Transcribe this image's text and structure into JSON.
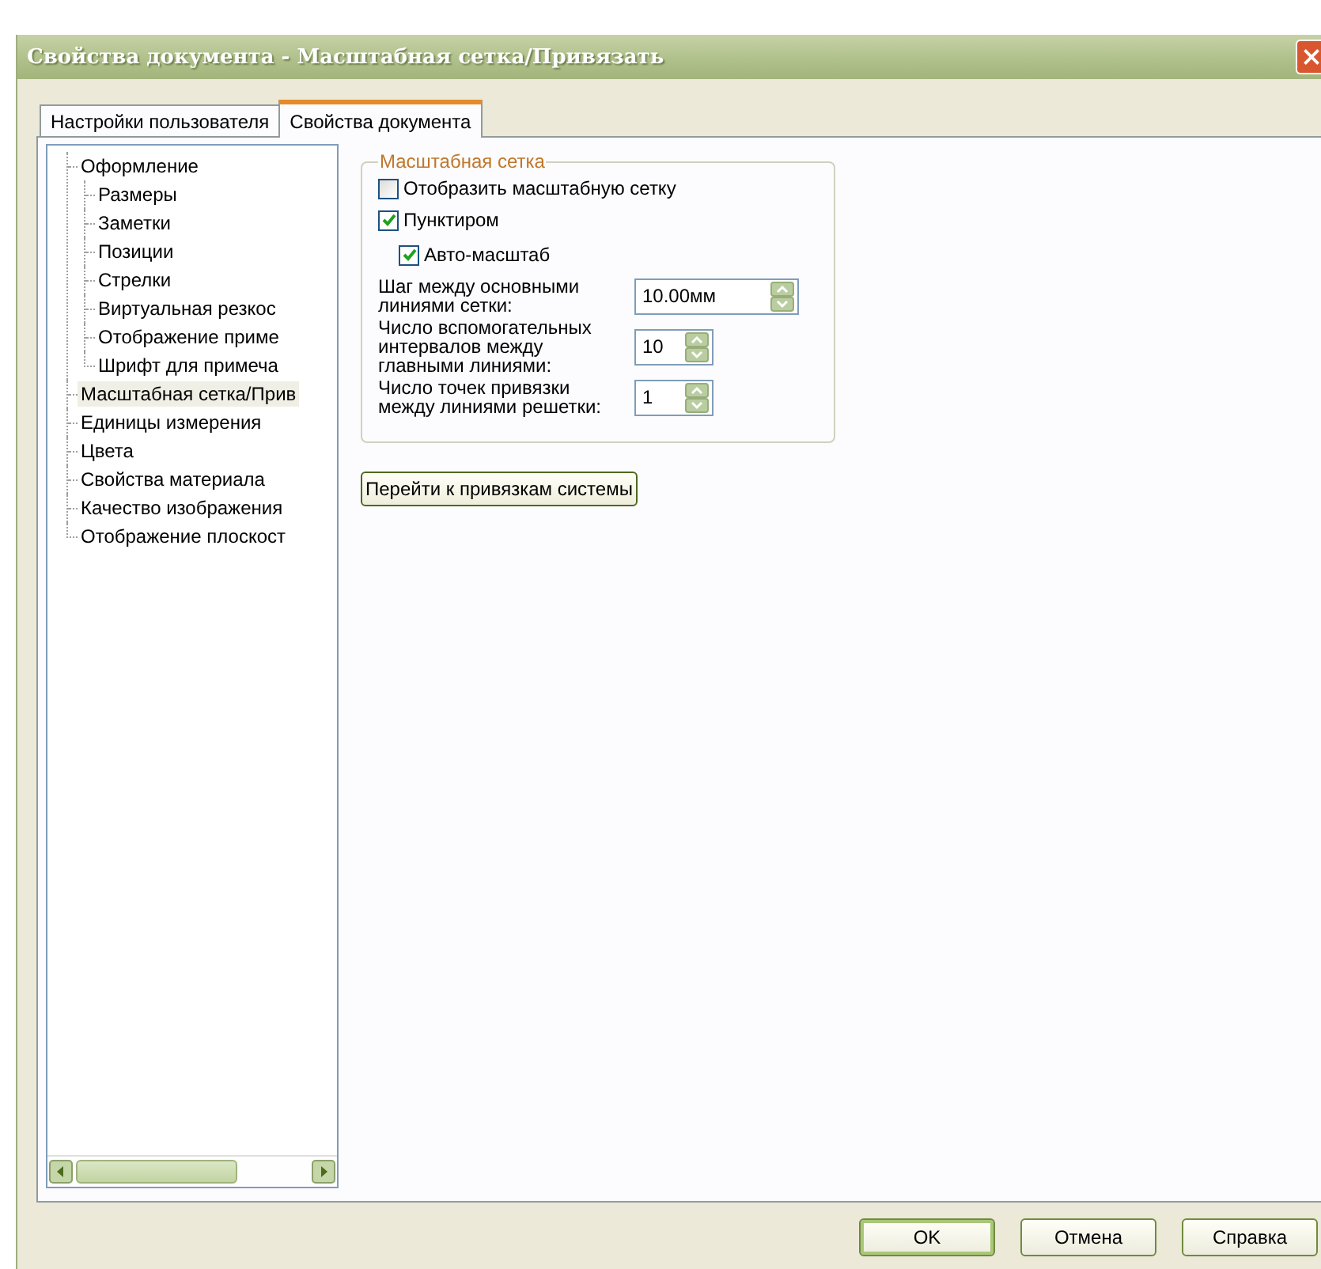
{
  "window": {
    "title": "Свойства документа - Масштабная сетка/Привязать"
  },
  "tabs": [
    {
      "label": "Настройки пользователя",
      "selected": false
    },
    {
      "label": "Свойства документа",
      "selected": true
    }
  ],
  "tree": {
    "items": [
      {
        "label": "Оформление",
        "selected": false,
        "children": [
          {
            "label": "Размеры",
            "selected": false
          },
          {
            "label": "Заметки",
            "selected": false
          },
          {
            "label": "Позиции",
            "selected": false
          },
          {
            "label": "Стрелки",
            "selected": false
          },
          {
            "label": "Виртуальная резкос",
            "selected": false
          },
          {
            "label": "Отображение приме",
            "selected": false
          },
          {
            "label": "Шрифт для примеча",
            "selected": false
          }
        ]
      },
      {
        "label": "Масштабная сетка/Прив",
        "selected": true
      },
      {
        "label": "Единицы измерения",
        "selected": false
      },
      {
        "label": "Цвета",
        "selected": false
      },
      {
        "label": "Свойства материала",
        "selected": false
      },
      {
        "label": "Качество изображения",
        "selected": false
      },
      {
        "label": "Отображение плоскост",
        "selected": false
      }
    ]
  },
  "grid_group": {
    "title": "Масштабная сетка",
    "checkboxes": [
      {
        "label": "Отобразить масштабную сетку",
        "checked": false
      },
      {
        "label": "Пунктиром",
        "checked": true,
        "children": [
          {
            "label": "Авто-масштаб",
            "checked": true
          }
        ]
      }
    ],
    "fields": [
      {
        "label": "Шаг между основными линиями сетки:",
        "value": "10.00мм",
        "kind": "wide"
      },
      {
        "label": "Число вспомогательных интервалов между главными линиями:",
        "value": "10",
        "kind": "narrow"
      },
      {
        "label": "Число точек привязки между линиями решетки:",
        "value": "1",
        "kind": "narrow"
      }
    ]
  },
  "link_button": "Перейти к привязкам системы",
  "buttons": [
    {
      "label": "OK",
      "default": true
    },
    {
      "label": "Отмена",
      "default": false
    },
    {
      "label": "Справка",
      "default": false
    }
  ]
}
